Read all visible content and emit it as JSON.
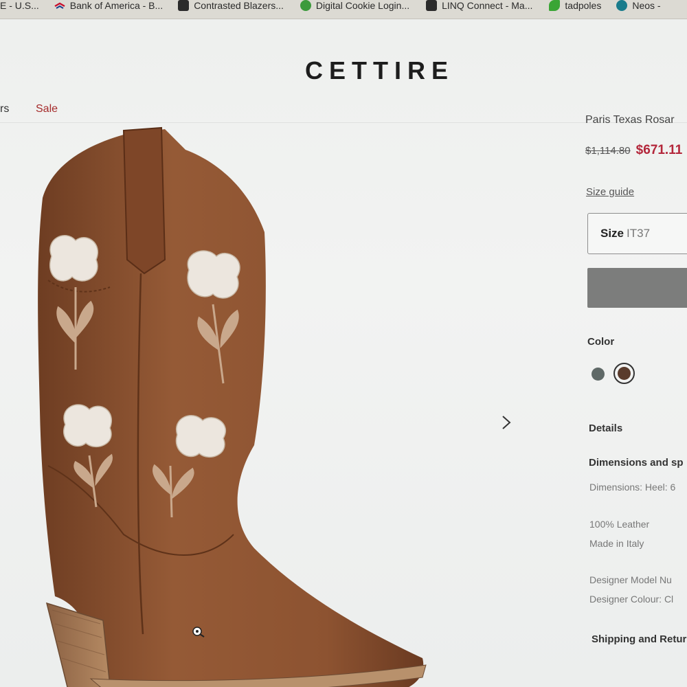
{
  "bookmarks": [
    {
      "label": "E - U.S...",
      "icon": "document-icon",
      "color": "#2a2a2a"
    },
    {
      "label": "Bank of America - B...",
      "icon": "bank-of-america-icon",
      "color": "#c8102e"
    },
    {
      "label": "Contrasted Blazers...",
      "icon": "bookmark-page-icon",
      "color": "#2b2b2b"
    },
    {
      "label": "Digital Cookie Login...",
      "icon": "girl-scouts-icon",
      "color": "#3c9a3c"
    },
    {
      "label": "LINQ Connect - Ma...",
      "icon": "linq-icon",
      "color": "#2b2b2b"
    },
    {
      "label": "tadpoles",
      "icon": "tadpoles-icon",
      "color": "#3aa535"
    },
    {
      "label": "Neos -",
      "icon": "neos-icon",
      "color": "#1a7c8c"
    }
  ],
  "header": {
    "logo": "CETTIRE"
  },
  "nav": {
    "partial": "rs",
    "sale": "Sale"
  },
  "product": {
    "title": "Paris Texas Rosar",
    "old_price": "$1,114.80",
    "new_price": "$671.11",
    "price_extra": "(",
    "size_guide": "Size guide",
    "size_label": "Size",
    "size_value": "IT37",
    "color_label": "Color",
    "colors": [
      {
        "name": "grey",
        "hex": "#5f6967"
      },
      {
        "name": "brown",
        "hex": "#5a3b2c",
        "selected": true
      }
    ],
    "details_label": "Details",
    "dimensions_heading": "Dimensions and sp",
    "dimensions_text": "Dimensions: Heel: 6",
    "material": "100% Leather",
    "origin": "Made in Italy",
    "model_number": "Designer Model Nu",
    "designer_colour": "Designer Colour: Cl",
    "shipping": "Shipping and Retur"
  },
  "colors": {
    "sale": "#a52b2b",
    "price": "#b3263a",
    "button": "#7c7d7c",
    "boot": "#8a5233"
  }
}
